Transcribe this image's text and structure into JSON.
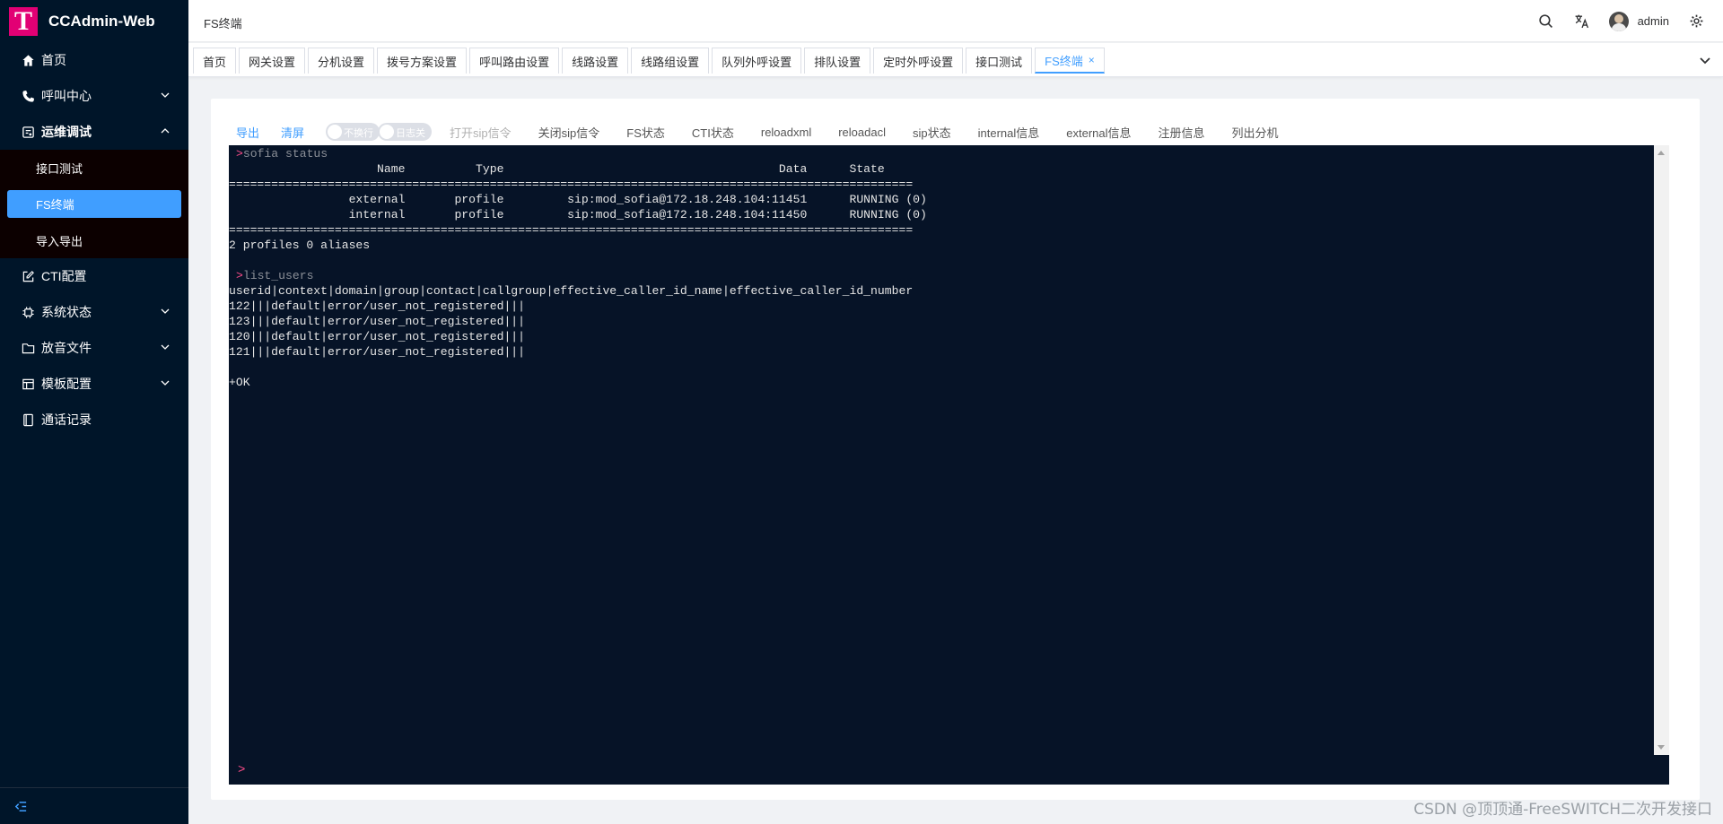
{
  "app": {
    "logo_letter": "T",
    "title": "CCAdmin-Web"
  },
  "sidebar": {
    "items": [
      {
        "label": "首页",
        "icon": "home-icon"
      },
      {
        "label": "呼叫中心",
        "icon": "phone-icon",
        "expandable": true
      },
      {
        "label": "运维调试",
        "icon": "debug-icon",
        "expandable": true,
        "open": true,
        "children": [
          {
            "label": "接口测试"
          },
          {
            "label": "FS终端",
            "active": true
          },
          {
            "label": "导入导出"
          }
        ]
      },
      {
        "label": "CTI配置",
        "icon": "edit-icon"
      },
      {
        "label": "系统状态",
        "icon": "cpu-icon",
        "expandable": true
      },
      {
        "label": "放音文件",
        "icon": "folder-icon",
        "expandable": true
      },
      {
        "label": "模板配置",
        "icon": "template-icon",
        "expandable": true
      },
      {
        "label": "通话记录",
        "icon": "book-icon"
      }
    ]
  },
  "header": {
    "breadcrumb": "FS终端",
    "username": "admin"
  },
  "tabs": [
    {
      "label": "首页"
    },
    {
      "label": "网关设置"
    },
    {
      "label": "分机设置"
    },
    {
      "label": "拨号方案设置"
    },
    {
      "label": "呼叫路由设置"
    },
    {
      "label": "线路设置"
    },
    {
      "label": "线路组设置"
    },
    {
      "label": "队列外呼设置"
    },
    {
      "label": "排队设置"
    },
    {
      "label": "定时外呼设置"
    },
    {
      "label": "接口测试"
    },
    {
      "label": "FS终端",
      "active": true,
      "close": "×"
    }
  ],
  "toolbar": {
    "export": "导出",
    "clear": "清屏",
    "switch1": "不换行",
    "switch2": "日志关",
    "open_sip": "打开sip信令",
    "close_sip": "关闭sip信令",
    "fs_status": "FS状态",
    "cti_status": "CTI状态",
    "reloadxml": "reloadxml",
    "reloadacl": "reloadacl",
    "sip_status": "sip状态",
    "internal_info": "internal信息",
    "external_info": "external信息",
    "register_info": "注册信息",
    "list_ext": "列出分机"
  },
  "terminal": {
    "lines": [
      {
        "type": "cmd",
        "text": "sofia status"
      },
      {
        "type": "out",
        "text": "                     Name          Type                                       Data      State"
      },
      {
        "type": "out",
        "text": "================================================================================================="
      },
      {
        "type": "out",
        "text": "                 external       profile         sip:mod_sofia@172.18.248.104:11451      RUNNING (0)"
      },
      {
        "type": "out",
        "text": "                 internal       profile         sip:mod_sofia@172.18.248.104:11450      RUNNING (0)"
      },
      {
        "type": "out",
        "text": "================================================================================================="
      },
      {
        "type": "out",
        "text": "2 profiles 0 aliases"
      },
      {
        "type": "out",
        "text": ""
      },
      {
        "type": "cmd",
        "text": "list_users"
      },
      {
        "type": "out",
        "text": "userid|context|domain|group|contact|callgroup|effective_caller_id_name|effective_caller_id_number"
      },
      {
        "type": "out",
        "text": "122|||default|error/user_not_registered|||"
      },
      {
        "type": "out",
        "text": "123|||default|error/user_not_registered|||"
      },
      {
        "type": "out",
        "text": "120|||default|error/user_not_registered|||"
      },
      {
        "type": "out",
        "text": "121|||default|error/user_not_registered|||"
      },
      {
        "type": "out",
        "text": ""
      },
      {
        "type": "out",
        "text": "+OK"
      }
    ],
    "prompt": ">"
  },
  "watermark": "CSDN @顶顶通-FreeSWITCH二次开发接口"
}
